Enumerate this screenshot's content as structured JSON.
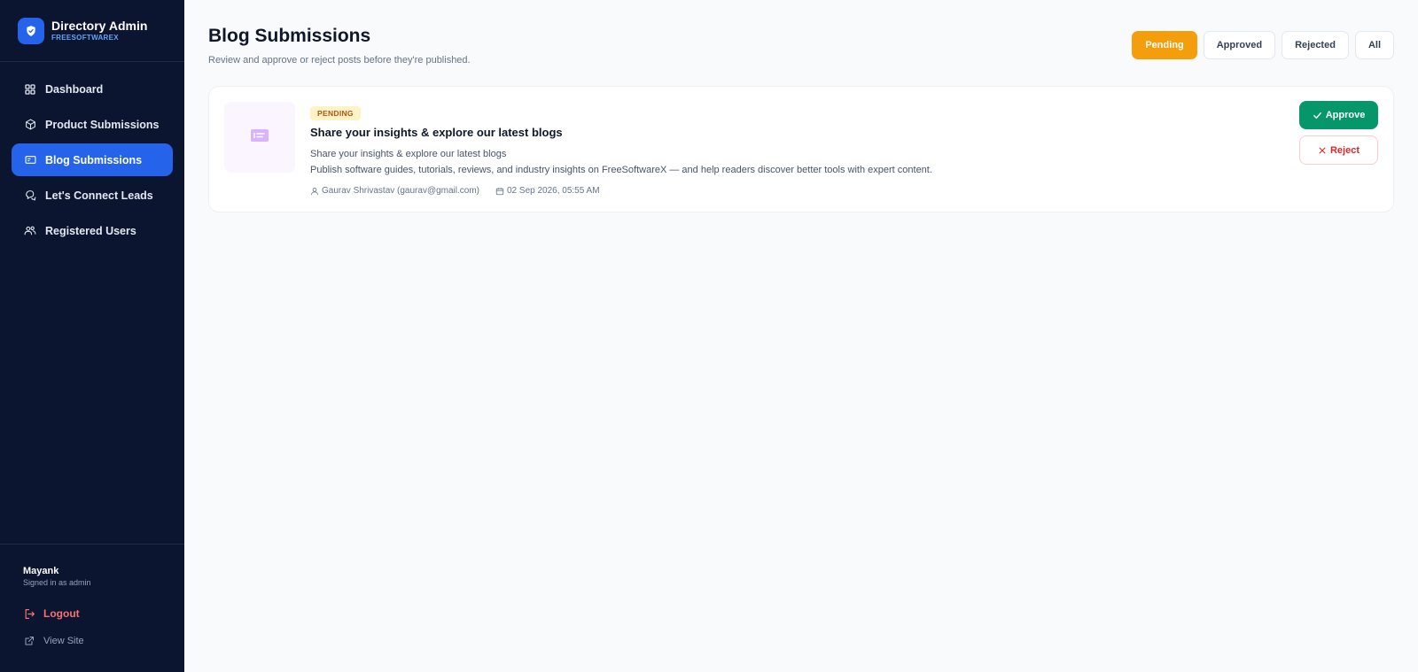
{
  "brand": {
    "title": "Directory Admin",
    "subtitle": "FREESOFTWAREX",
    "icon": "shield-icon",
    "accent": "#2563eb"
  },
  "sidebar": {
    "items": [
      {
        "label": "Dashboard",
        "icon": "grid-icon",
        "active": false
      },
      {
        "label": "Product Submissions",
        "icon": "box-icon",
        "active": false
      },
      {
        "label": "Blog Submissions",
        "icon": "newspaper-icon",
        "active": true
      },
      {
        "label": "Let's Connect Leads",
        "icon": "chat-icon",
        "active": false
      },
      {
        "label": "Registered Users",
        "icon": "users-icon",
        "active": false
      }
    ],
    "footer": {
      "user_name": "Mayank",
      "user_role": "Signed in as admin",
      "logout_label": "Logout",
      "view_site_label": "View Site"
    }
  },
  "header": {
    "title": "Blog Submissions",
    "subtitle": "Review and approve or reject posts before they're published."
  },
  "filters": {
    "items": [
      {
        "label": "Pending",
        "active": true
      },
      {
        "label": "Approved",
        "active": false
      },
      {
        "label": "Rejected",
        "active": false
      },
      {
        "label": "All",
        "active": false
      }
    ],
    "active_color": "#f59e0b"
  },
  "submissions": [
    {
      "status": "PENDING",
      "title": "Share your insights & explore our latest blogs",
      "summary": "Share your insights & explore our latest blogs",
      "description": "Publish software guides, tutorials, reviews, and industry insights on FreeSoftwareX — and help readers discover better tools with expert content.",
      "author": "Gaurav Shrivastav (gaurav@gmail.com)",
      "date": "02 Sep 2026, 05:55 AM",
      "approve_label": "Approve",
      "reject_label": "Reject"
    }
  ],
  "colors": {
    "sidebar_bg": "#0c1530",
    "approve": "#059669",
    "reject": "#dc2626",
    "pending_badge": "#b45309"
  }
}
